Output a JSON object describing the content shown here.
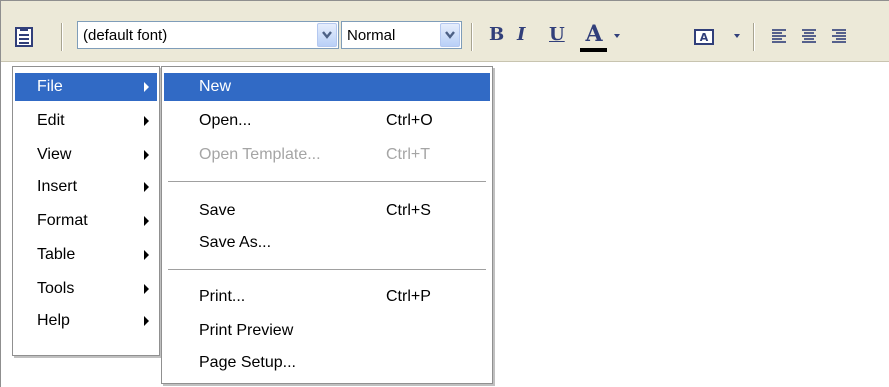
{
  "toolbar": {
    "font_value": "(default font)",
    "size_value": "Normal",
    "bold_label": "B",
    "italic_label": "I",
    "underline_label": "U",
    "font_color_label": "A",
    "colors": {
      "toolbar_bg": "#ece9d8",
      "icon": "#313f7a",
      "highlight_blue": "#316ac5"
    },
    "icons": [
      "menu-icon",
      "chevron-down-icon",
      "font-color-icon",
      "highlight-icon",
      "align-left-icon",
      "align-center-icon",
      "align-right-icon"
    ]
  },
  "main_menu": {
    "items": [
      {
        "label": "File",
        "selected": true
      },
      {
        "label": "Edit"
      },
      {
        "label": "View"
      },
      {
        "label": "Insert"
      },
      {
        "label": "Format"
      },
      {
        "label": "Table"
      },
      {
        "label": "Tools"
      },
      {
        "label": "Help"
      }
    ]
  },
  "file_menu": {
    "items": [
      {
        "label": "New",
        "shortcut": "",
        "selected": true
      },
      {
        "label": "Open...",
        "shortcut": "Ctrl+O"
      },
      {
        "label": "Open Template...",
        "shortcut": "Ctrl+T",
        "disabled": true
      },
      {
        "label": "Save",
        "shortcut": "Ctrl+S"
      },
      {
        "label": "Save As...",
        "shortcut": ""
      },
      {
        "label": "Print...",
        "shortcut": "Ctrl+P"
      },
      {
        "label": "Print Preview",
        "shortcut": ""
      },
      {
        "label": "Page Setup...",
        "shortcut": ""
      }
    ]
  }
}
